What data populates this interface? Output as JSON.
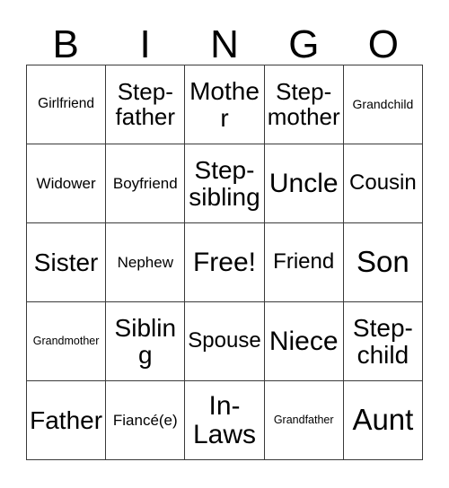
{
  "header": {
    "letters": [
      "B",
      "I",
      "N",
      "G",
      "O"
    ]
  },
  "grid": {
    "rows": 5,
    "columns": 5,
    "border_color": "#3a3a3a",
    "background_color": "#ffffff",
    "text_color": "#000000",
    "cells": [
      {
        "label": "Girlfriend",
        "size": "fs-sm",
        "free": false
      },
      {
        "label": "Step-father",
        "size": "fs-xl",
        "free": false
      },
      {
        "label": "Mother",
        "size": "fs-xxl",
        "free": false
      },
      {
        "label": "Step-mother",
        "size": "fs-xl",
        "free": false
      },
      {
        "label": "Grandchild",
        "size": "fs-s",
        "free": false
      },
      {
        "label": "Widower",
        "size": "fs-m",
        "free": false
      },
      {
        "label": "Boyfriend",
        "size": "fs-m",
        "free": false
      },
      {
        "label": "Step-sibling",
        "size": "fs-xxl",
        "free": false
      },
      {
        "label": "Uncle",
        "size": "fs-3xl",
        "free": false
      },
      {
        "label": "Cousin",
        "size": "fs-l",
        "free": false
      },
      {
        "label": "Sister",
        "size": "fs-xxl",
        "free": false
      },
      {
        "label": "Nephew",
        "size": "fs-m",
        "free": false
      },
      {
        "label": "Free!",
        "size": "fs-3xl",
        "free": true
      },
      {
        "label": "Friend",
        "size": "fs-l",
        "free": false
      },
      {
        "label": "Son",
        "size": "fs-4xl",
        "free": false
      },
      {
        "label": "Grandmother",
        "size": "fs-xs",
        "free": false
      },
      {
        "label": "Sibling",
        "size": "fs-xxl",
        "free": false
      },
      {
        "label": "Spouse",
        "size": "fs-l",
        "free": false
      },
      {
        "label": "Niece",
        "size": "fs-3xl",
        "free": false
      },
      {
        "label": "Step-child",
        "size": "fs-xxl",
        "free": false
      },
      {
        "label": "Father",
        "size": "fs-xxl",
        "free": false
      },
      {
        "label": "Fiancé(e)",
        "size": "fs-m",
        "free": false
      },
      {
        "label": "In-Laws",
        "size": "fs-3xl",
        "free": false
      },
      {
        "label": "Grandfather",
        "size": "fs-xs",
        "free": false
      },
      {
        "label": "Aunt",
        "size": "fs-4xl",
        "free": false
      }
    ]
  }
}
